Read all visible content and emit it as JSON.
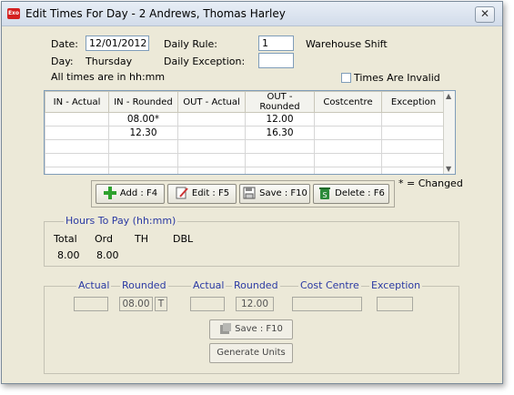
{
  "window": {
    "app_icon_text": "Exo",
    "title": "Edit Times For Day - 2  Andrews, Thomas Harley",
    "close_glyph": "✕"
  },
  "header": {
    "date_label": "Date:",
    "date_value": "12/01/2012",
    "daily_rule_label": "Daily Rule:",
    "daily_rule_value": "1",
    "daily_rule_name": "Warehouse Shift",
    "day_label": "Day:",
    "day_value": "Thursday",
    "daily_exception_label": "Daily Exception:",
    "daily_exception_value": "",
    "times_note": "All times are in hh:mm",
    "invalid_label": "Times Are Invalid",
    "invalid_checked": false
  },
  "grid": {
    "columns": [
      "IN - Actual",
      "IN - Rounded",
      "OUT - Actual",
      "OUT - Rounded",
      "Costcentre",
      "Exception"
    ],
    "rows": [
      [
        "",
        "08.00*",
        "",
        "12.00",
        "",
        ""
      ],
      [
        "",
        "12.30",
        "",
        "16.30",
        "",
        ""
      ],
      [
        "",
        "",
        "",
        "",
        "",
        ""
      ],
      [
        "",
        "",
        "",
        "",
        "",
        ""
      ],
      [
        "",
        "",
        "",
        "",
        "",
        ""
      ]
    ],
    "changed_note": "* = Changed"
  },
  "toolbar": {
    "add_label": "Add : F4",
    "edit_label": "Edit : F5",
    "save_label": "Save : F10",
    "delete_label": "Delete : F6"
  },
  "hours": {
    "title": "Hours To Pay (hh:mm)",
    "headers": [
      "Total",
      "Ord",
      "TH",
      "DBL"
    ],
    "values": [
      "8.00",
      "8.00",
      "",
      ""
    ]
  },
  "editor": {
    "headers": [
      "Actual",
      "Rounded",
      "Actual",
      "Rounded",
      "Cost Centre",
      "Exception"
    ],
    "in_actual": "",
    "in_rounded": "08.00",
    "in_flag": "T",
    "out_actual": "",
    "out_rounded": "12.00",
    "cost_centre": "",
    "exception": "",
    "save_label": "Save : F10",
    "generate_label": "Generate Units"
  },
  "colors": {
    "window_bg": "#ece9d8",
    "group_title": "#2b3aa3",
    "add_icon": "#2ea12e",
    "delete_icon": "#2c8a3a"
  }
}
